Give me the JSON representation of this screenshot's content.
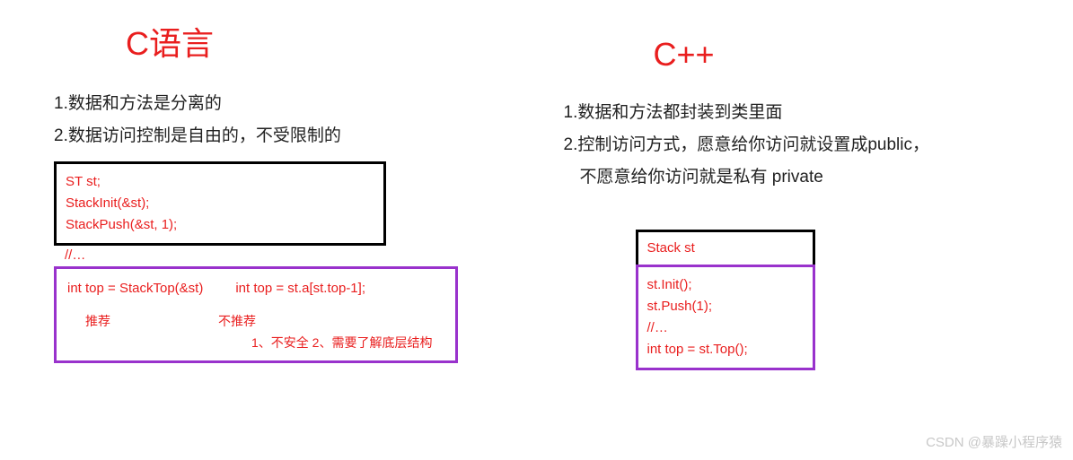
{
  "left": {
    "title": "C语言",
    "point1": "1.数据和方法是分离的",
    "point2": "2.数据访问控制是自由的，不受限制的",
    "black_code": {
      "line1": "ST st;",
      "line2": "StackInit(&st);",
      "line3": "StackPush(&st, 1);"
    },
    "comment_line": "//…",
    "purple_code": {
      "line1a": "int top = StackTop(&st)",
      "line1b": "int top = st.a[st.top-1];",
      "rec1": "推荐",
      "rec2": "不推荐",
      "reason": "1、不安全   2、需要了解底层结构"
    }
  },
  "right": {
    "title": "C++",
    "point1": "1.数据和方法都封装到类里面",
    "point2": "2.控制访问方式，愿意给你访问就设置成public，",
    "point2b": "不愿意给你访问就是私有 private",
    "black_code": {
      "line1": "Stack st"
    },
    "purple_code": {
      "line1": "st.Init();",
      "line2": "st.Push(1);",
      "line3": "//…",
      "line4": "int top = st.Top();"
    }
  },
  "watermark": "CSDN @暴躁小程序猿"
}
